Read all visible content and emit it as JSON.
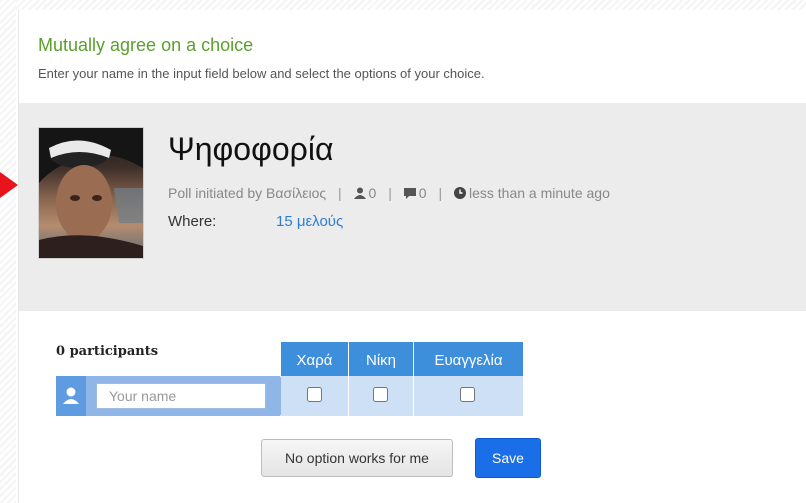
{
  "intro": {
    "heading": "Mutually agree on a choice",
    "description": "Enter your name in the input field below and select the options of your choice."
  },
  "poll": {
    "title": "Ψηφοφορία",
    "initiated_by": "Poll initiated by Βασίλειος",
    "participants_count": "0",
    "comments_count": "0",
    "time_ago": "less than a minute ago",
    "where_label": "Where:",
    "where_value": "15 μελούς",
    "icons": [
      "user-icon",
      "comment-icon",
      "clock-icon"
    ]
  },
  "voting": {
    "participants_label": "0 participants",
    "name_placeholder": "Your name",
    "options": [
      {
        "label": "Χαρά",
        "checked": false
      },
      {
        "label": "Νίκη",
        "checked": false
      },
      {
        "label": "Ευαγγελία",
        "checked": false
      }
    ]
  },
  "actions": {
    "no_option_label": "No option works for me",
    "save_label": "Save"
  },
  "colors": {
    "heading": "#5aa02c",
    "option_header": "#3d8fdc",
    "option_cell": "#cde0f6",
    "save_button": "#1a6fe8",
    "link": "#2a7fd4",
    "pointer": "#e8141b"
  }
}
